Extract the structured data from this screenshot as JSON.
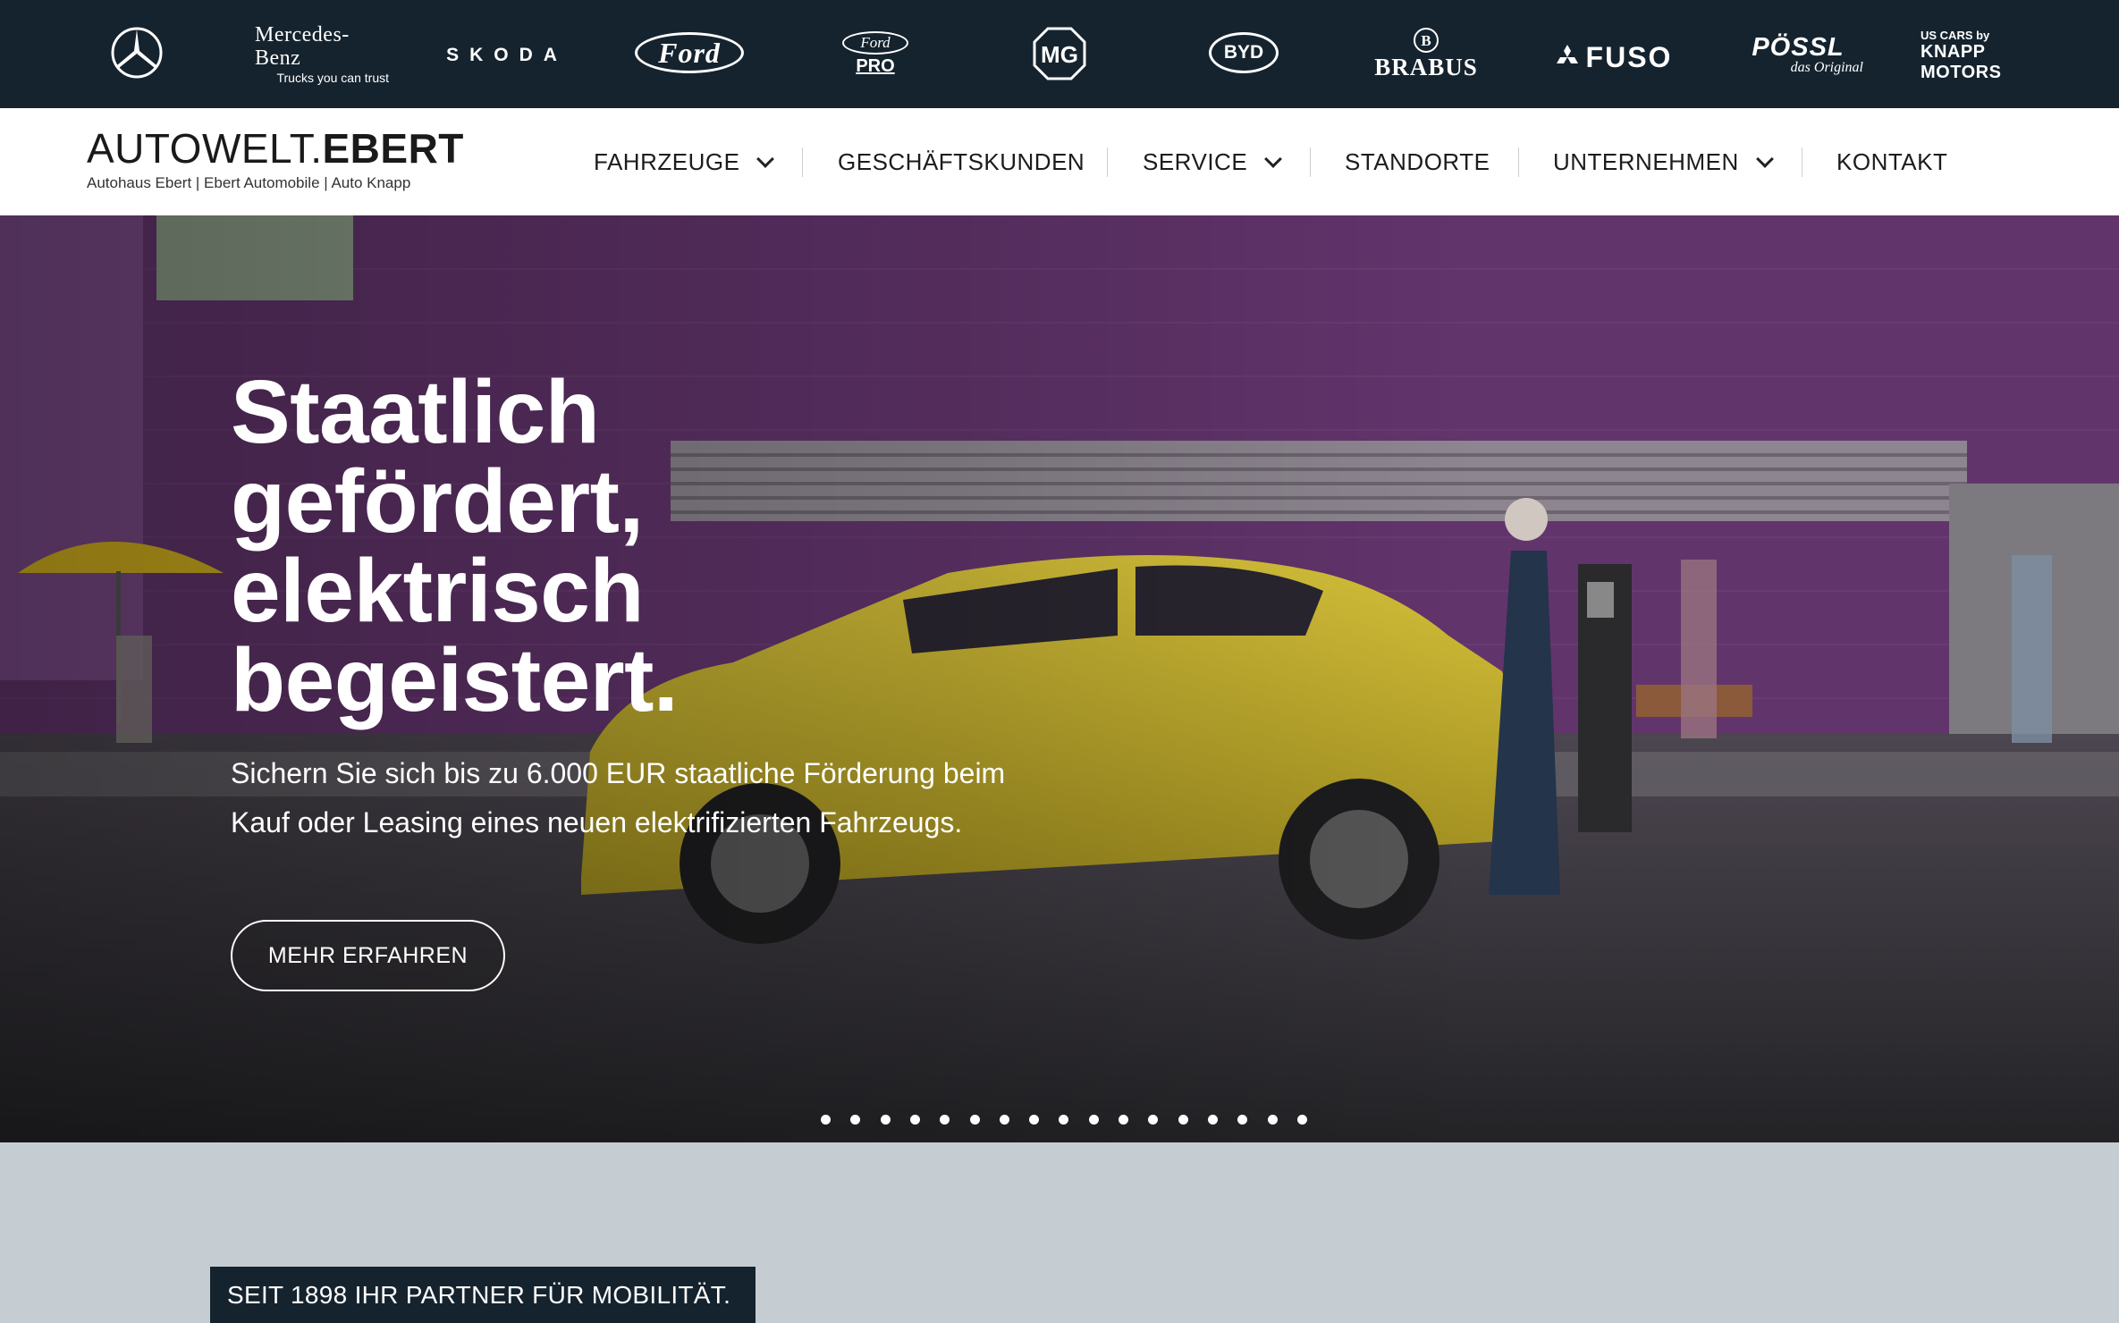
{
  "brands": {
    "mercedes_star_icon": "mercedes-star",
    "mercedes_benz": {
      "name": "Mercedes-Benz",
      "tagline": "Trucks you can trust"
    },
    "skoda": "SKODA",
    "ford": "Ford",
    "ford_pro": {
      "top": "Ford",
      "bottom": "PRO"
    },
    "mg": "MG",
    "byd": "BYD",
    "brabus": "BRABUS",
    "fuso": "FUSO",
    "possl": {
      "name": "PÖSSL",
      "tagline": "das Original"
    },
    "knapp": {
      "top": "US CARS by",
      "bottom": "KNAPP MOTORS"
    }
  },
  "header": {
    "logo_light": "AUTOWELT.",
    "logo_bold": "EBERT",
    "logo_sub": "Autohaus Ebert | Ebert Automobile | Auto Knapp"
  },
  "nav": {
    "fahrzeuge": "FAHRZEUGE",
    "geschaeftskunden": "GESCHÄFTSKUNDEN",
    "service": "SERVICE",
    "standorte": "STANDORTE",
    "unternehmen": "UNTERNEHMEN",
    "kontakt": "KONTAKT"
  },
  "hero": {
    "title_lines": [
      "Staatlich",
      "gefördert,",
      "elektrisch",
      "begeistert."
    ],
    "text": "Sichern Sie sich bis zu 6.000 EUR staatliche Förderung beim Kauf oder Leasing eines neuen elektrifizierten Fahrzeugs.",
    "button": "MEHR ERFAHREN",
    "slide_count": 17,
    "active_slide": 1
  },
  "tagline": "SEIT 1898 IHR PARTNER FÜR MOBILITÄT.",
  "colors": {
    "brandbar_bg": "#15232e",
    "car": "#c9b32a",
    "wall": "#6a3a73"
  }
}
